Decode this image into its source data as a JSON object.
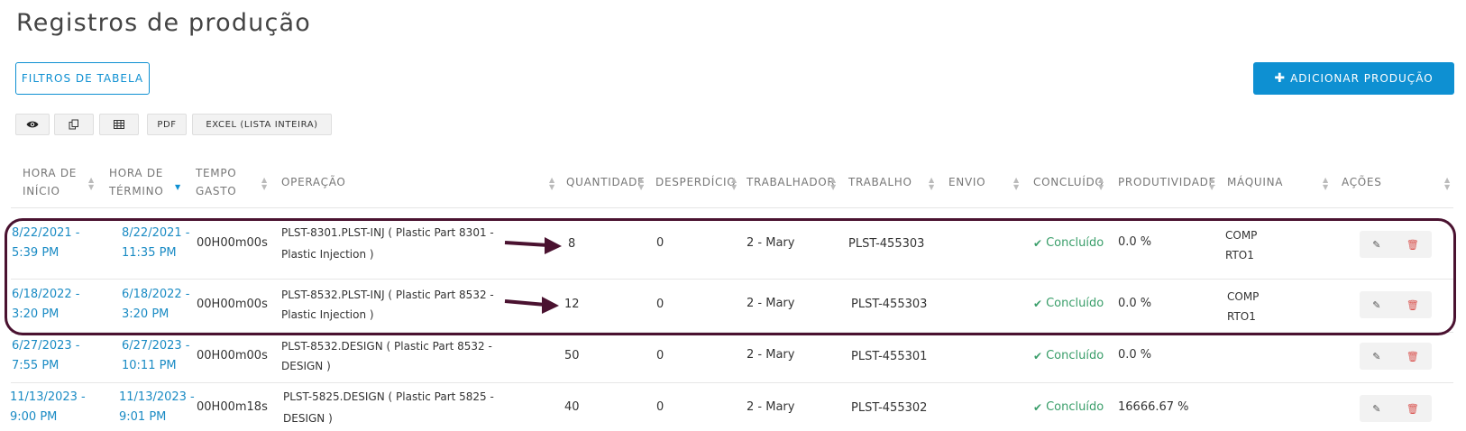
{
  "page": {
    "title": "Registros de produção",
    "filters_label": "FILTROS DE TABELA",
    "add_label": "ADICIONAR PRODUÇÃO",
    "add_icon": "plus-icon"
  },
  "toolbar": {
    "view_icon": "eye-icon",
    "copy_icon": "copy-icon",
    "csv_icon": "table-icon",
    "pdf_label": "PDF",
    "excel_label": "EXCEL (LISTA INTEIRA)"
  },
  "columns": {
    "start_1": "HORA DE",
    "start_2": "INÍCIO",
    "end_1": "HORA DE",
    "end_2": "TÉRMINO",
    "spent_1": "TEMPO",
    "spent_2": "GASTO",
    "operation": "OPERAÇÃO",
    "quantity": "QUANTIDADE",
    "waste": "DESPERDÍCIO",
    "worker": "TRABALHADOR",
    "job": "TRABALHO",
    "shipment": "ENVIO",
    "done": "CONCLUÍDO",
    "productivity": "PRODUTIVIDADE",
    "machine": "MÁQUINA",
    "actions": "AÇÕES"
  },
  "rows": [
    {
      "start_1": "8/22/2021 -",
      "start_2": "5:39 PM",
      "end_1": "8/22/2021 -",
      "end_2": "11:35 PM",
      "spent": "00H00m00s",
      "op_1": "PLST-8301.PLST-INJ ( Plastic Part 8301 -",
      "op_2": "Plastic Injection )",
      "quantity": "8",
      "waste": "0",
      "worker": "2 - Mary",
      "job": "PLST-455303",
      "done": "Concluído",
      "productivity": "0.0 %",
      "machine_1": "COMP",
      "machine_2": "RTO1"
    },
    {
      "start_1": "6/18/2022 -",
      "start_2": "3:20 PM",
      "end_1": "6/18/2022 -",
      "end_2": "3:20 PM",
      "spent": "00H00m00s",
      "op_1": "PLST-8532.PLST-INJ ( Plastic Part 8532 -",
      "op_2": "Plastic Injection )",
      "quantity": "12",
      "waste": "0",
      "worker": "2 - Mary",
      "job": "PLST-455303",
      "done": "Concluído",
      "productivity": "0.0 %",
      "machine_1": "COMP",
      "machine_2": "RTO1"
    },
    {
      "start_1": "6/27/2023 -",
      "start_2": "7:55 PM",
      "end_1": "6/27/2023 -",
      "end_2": "10:11 PM",
      "spent": "00H00m00s",
      "op_1": "PLST-8532.DESIGN ( Plastic Part 8532 -",
      "op_2": "DESIGN )",
      "quantity": "50",
      "waste": "0",
      "worker": "2 - Mary",
      "job": "PLST-455301",
      "done": "Concluído",
      "productivity": "0.0 %",
      "machine_1": "",
      "machine_2": ""
    },
    {
      "start_1": "11/13/2023 -",
      "start_2": "9:00 PM",
      "end_1": "11/13/2023 -",
      "end_2": "9:01 PM",
      "spent": "00H00m18s",
      "op_1": "PLST-5825.DESIGN ( Plastic Part 5825 -",
      "op_2": "DESIGN )",
      "quantity": "40",
      "waste": "0",
      "worker": "2 - Mary",
      "job": "PLST-455302",
      "done": "Concluído",
      "productivity": "16666.67 %",
      "machine_1": "",
      "machine_2": ""
    }
  ],
  "icons": {
    "edit": "edit-icon",
    "delete": "trash-icon",
    "check": "check-icon"
  },
  "colors": {
    "accent": "#0e90d2",
    "done": "#3a9e6a",
    "highlight": "#4a1230",
    "delete": "#d9534f"
  }
}
